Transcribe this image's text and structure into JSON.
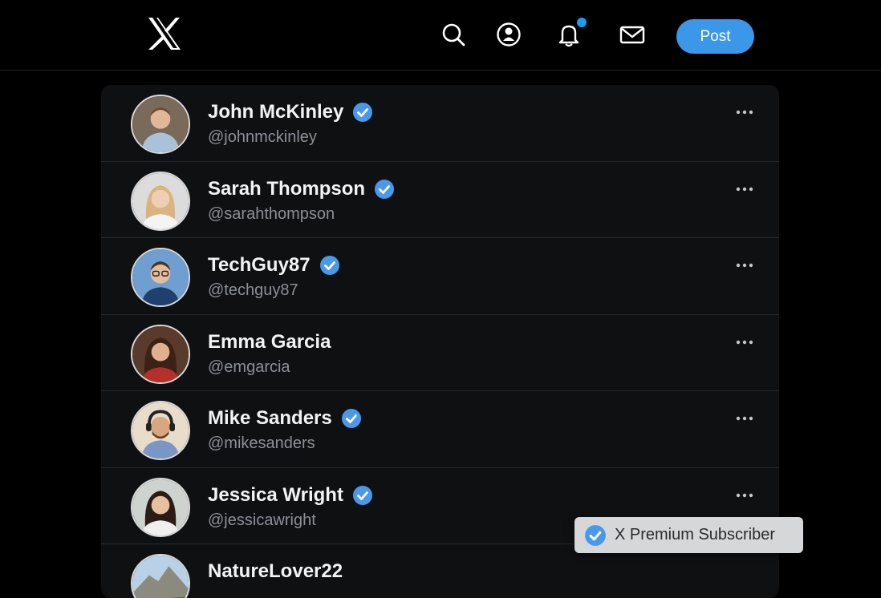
{
  "app": {
    "logo": "x-logo"
  },
  "header": {
    "icons": [
      "search-icon",
      "profile-icon",
      "bell-icon",
      "mail-icon"
    ],
    "post_label": "Post",
    "accent": "#3b97e8"
  },
  "users": [
    {
      "name": "John McKinley",
      "handle": "@johnmckinley",
      "verified": true
    },
    {
      "name": "Sarah Thompson",
      "handle": "@sarahthompson",
      "verified": true
    },
    {
      "name": "TechGuy87",
      "handle": "@techguy87",
      "verified": true
    },
    {
      "name": "Emma Garcia",
      "handle": "@emgarcia",
      "verified": false
    },
    {
      "name": "Mike Sanders",
      "handle": "@mikesanders",
      "verified": true
    },
    {
      "name": "Jessica Wright",
      "handle": "@jessicawright",
      "verified": true
    },
    {
      "name": "NatureLover22",
      "handle": "",
      "verified": false
    }
  ],
  "tooltip": {
    "text": "X Premium Subscriber"
  }
}
